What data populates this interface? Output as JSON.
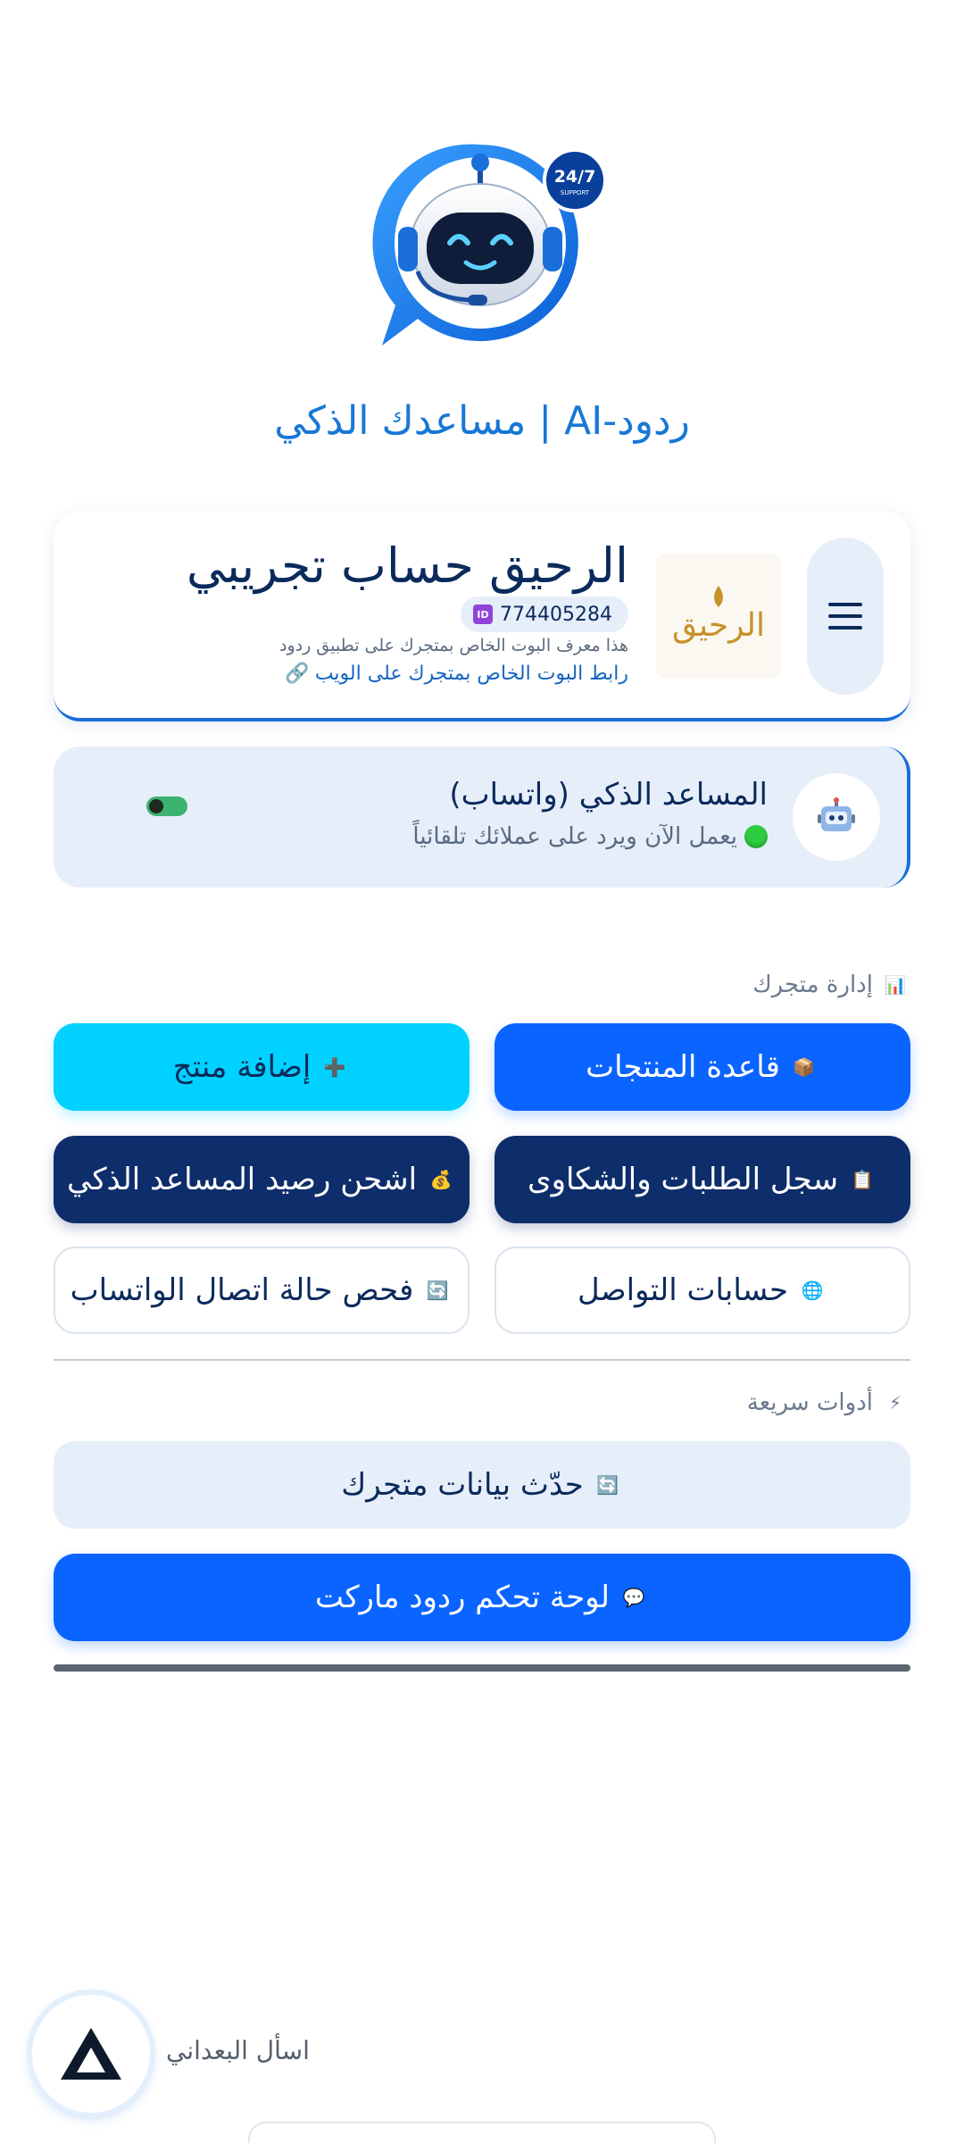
{
  "app": {
    "title": "ردود-AI | مساعدك الذكي",
    "logo_badge_top": "24/7",
    "logo_badge_bottom": "SUPPORT"
  },
  "store": {
    "name": "الرحيق  حساب تجريبي",
    "logo_text": "الرحيق",
    "id_value": "774405284",
    "id_badge": "ID",
    "description": "هذا معرف البوت الخاص بمتجرك على تطبيق ردود",
    "link_text": "رابط البوت الخاص بمتجرك على الويب",
    "link_icon": "🔗"
  },
  "assistant": {
    "title": "المساعد الذكي (واتساب)",
    "status": "يعمل الآن ويرد على عملائك تلقائياً",
    "enabled": true
  },
  "sections": {
    "manage": "إدارة متجرك",
    "quick": "أدوات سريعة"
  },
  "buttons": {
    "products": "قاعدة المنتجات",
    "add_product": "إضافة منتج",
    "orders": "سجل الطلبات والشكاوى",
    "recharge": "اشحن رصيد المساعد الذكي",
    "social": "حسابات التواصل",
    "check_whatsapp": "فحص حالة اتصال الواتساب",
    "update_data": "حدّث بيانات متجرك",
    "dashboard": "لوحة تحكم ردود ماركت"
  },
  "icons": {
    "chart": "📊",
    "box": "📦",
    "plus": "➕",
    "clipboard": "📋",
    "money": "💰",
    "globe": "🌐",
    "refresh": "🔄",
    "bolt": "⚡",
    "speech": "💬"
  },
  "ask": {
    "label": "اسأل البعداني"
  },
  "colors": {
    "accent": "#0a64ff",
    "navy": "#0e2d6b",
    "cyan": "#00d1ff",
    "title_blue": "#1877d6",
    "light_bg": "#e6eef9"
  }
}
